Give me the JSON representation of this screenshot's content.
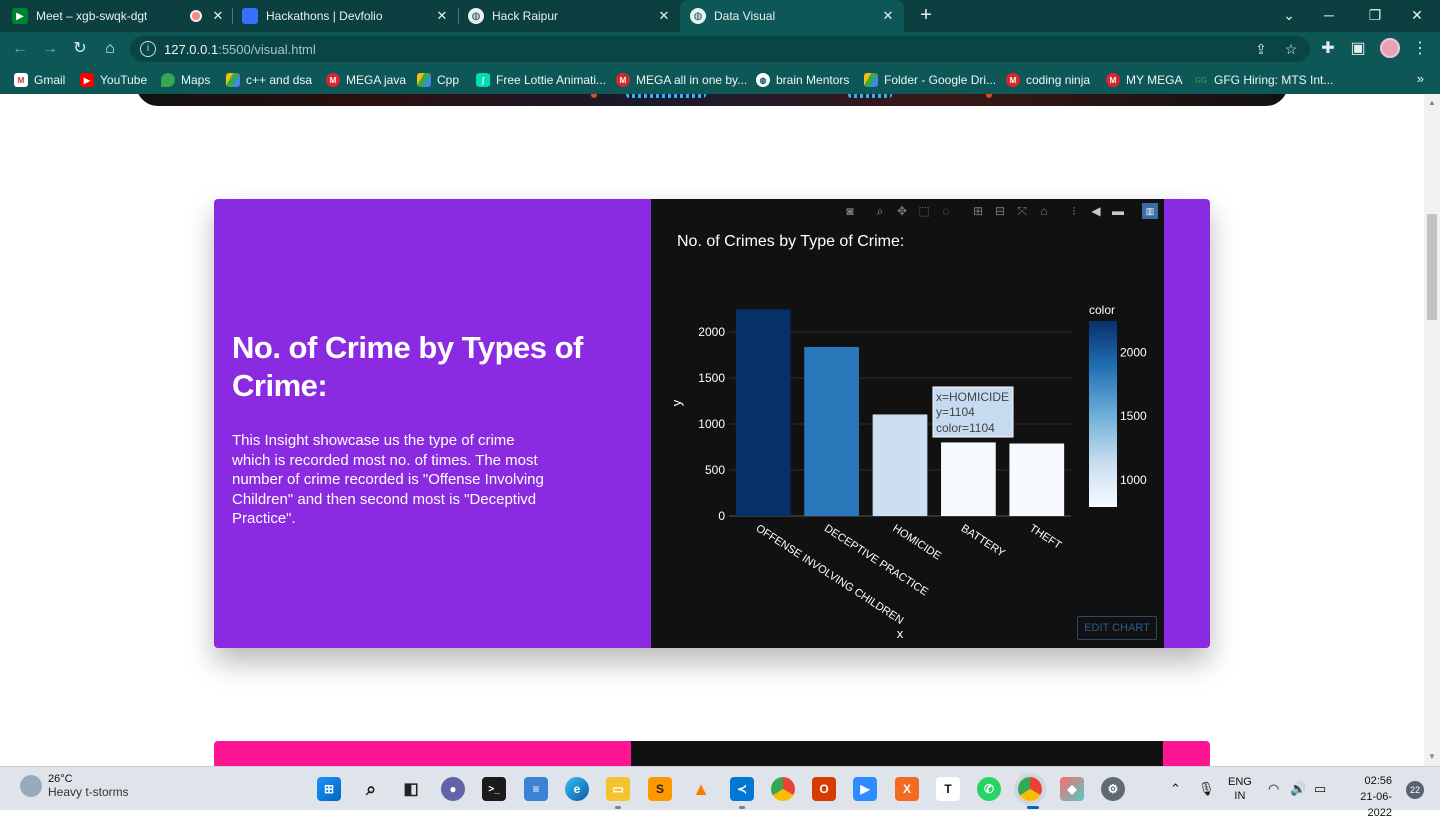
{
  "browser": {
    "tabs": [
      {
        "title": "Meet – xgb-swqk-dgt",
        "icon": "google-meet-icon",
        "recording": true
      },
      {
        "title": "Hackathons | Devfolio",
        "icon": "devfolio-icon"
      },
      {
        "title": "Hack Raipur",
        "icon": "globe-icon"
      },
      {
        "title": "Data Visual",
        "icon": "globe-icon",
        "active": true
      }
    ],
    "url_host": "127.0.0.1",
    "url_rest": ":5500/visual.html",
    "bookmarks": [
      {
        "label": "Gmail",
        "icon": "gmail-icon"
      },
      {
        "label": "YouTube",
        "icon": "youtube-icon"
      },
      {
        "label": "Maps",
        "icon": "maps-icon"
      },
      {
        "label": "c++ and dsa",
        "icon": "drive-icon"
      },
      {
        "label": "MEGA java",
        "icon": "mega-icon"
      },
      {
        "label": "Cpp",
        "icon": "drive-icon"
      },
      {
        "label": "Free Lottie Animati...",
        "icon": "lottie-icon"
      },
      {
        "label": "MEGA all in one by...",
        "icon": "mega-icon"
      },
      {
        "label": "brain Mentors",
        "icon": "globe-icon"
      },
      {
        "label": "Folder - Google Dri...",
        "icon": "drive-icon"
      },
      {
        "label": "coding ninja",
        "icon": "mega-icon"
      },
      {
        "label": "MY MEGA",
        "icon": "mega-icon"
      },
      {
        "label": "GFG Hiring: MTS Int...",
        "icon": "gfg-icon"
      }
    ],
    "more": "»"
  },
  "card": {
    "title": "No. of Crime by Types of Crime:",
    "text": "This Insight showcase us the type of crime which is recorded most no. of times. The most number of crime recorded is \"Offense Involving Children\" and then second most is \"Deceptivd Practice\"."
  },
  "chart_data": {
    "type": "bar",
    "title": "No. of Crimes by Type of Crime:",
    "categories": [
      "OFFENSE INVOLVING CHILDREN",
      "DECEPTIVE PRACTICE",
      "HOMICIDE",
      "BATTERY",
      "THEFT"
    ],
    "values": [
      2245,
      1838,
      1104,
      800,
      788
    ],
    "xlabel": "x",
    "ylabel": "y",
    "ylim": [
      0,
      2370
    ],
    "yticks": [
      0,
      500,
      1000,
      1500,
      2000
    ],
    "colorbar": {
      "title": "color",
      "ticks": [
        1000,
        1500,
        2000
      ],
      "range": [
        788,
        2245
      ]
    },
    "tooltip": {
      "x": "x=HOMICIDE",
      "y": "y=1104",
      "color": "color=1104"
    },
    "grid": true,
    "edit_label": "EDIT CHART"
  },
  "taskbar": {
    "temperature": "26°C",
    "weather": "Heavy t-storms",
    "lang1": "ENG",
    "lang2": "IN",
    "time": "02:56",
    "date": "21-06-2022",
    "notifications": "22"
  }
}
